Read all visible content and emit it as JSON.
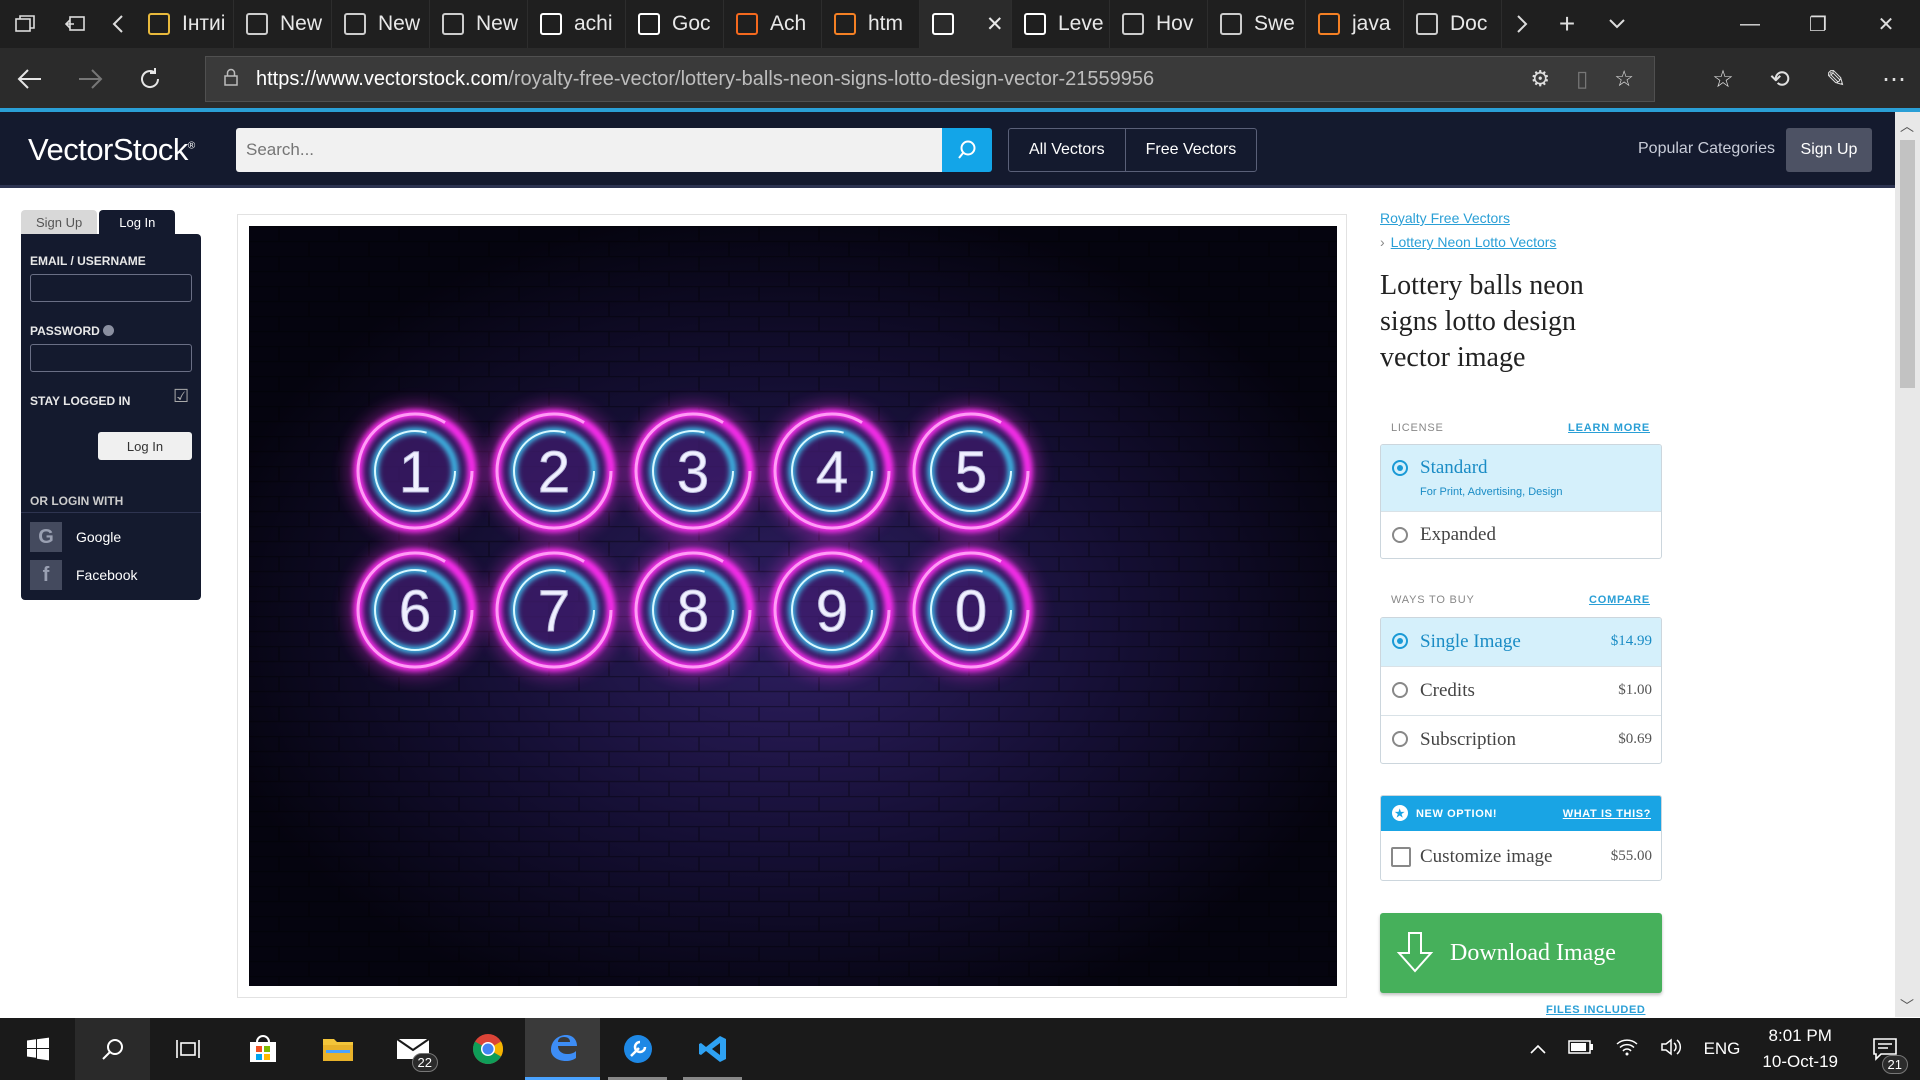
{
  "browser": {
    "tabs": [
      {
        "label": "Інтиі",
        "icon": "bookmark-icon",
        "color": "#e8b93c"
      },
      {
        "label": "New",
        "icon": "new-tab-icon",
        "color": "#cccccc"
      },
      {
        "label": "New",
        "icon": "new-tab-icon",
        "color": "#cccccc"
      },
      {
        "label": "New",
        "icon": "new-tab-icon",
        "color": "#cccccc"
      },
      {
        "label": "achi",
        "icon": "google-icon",
        "color": "#ffffff"
      },
      {
        "label": "Goc",
        "icon": "google-icon",
        "color": "#ffffff"
      },
      {
        "label": "Ach",
        "icon": "blogger-icon",
        "color": "#f4691e"
      },
      {
        "label": "htm",
        "icon": "stackoverflow-icon",
        "color": "#f48024"
      },
      {
        "label": "",
        "icon": "vectorstock-icon",
        "color": "#ffffff"
      },
      {
        "label": "Leve",
        "icon": "vectorstock-icon",
        "color": "#ffffff"
      },
      {
        "label": "Hov",
        "icon": "codepen-icon",
        "color": "#cccccc"
      },
      {
        "label": "Swe",
        "icon": "window-icon",
        "color": "#cccccc"
      },
      {
        "label": "java",
        "icon": "stackoverflow-icon",
        "color": "#f48024"
      },
      {
        "label": "Doc",
        "icon": "window-icon",
        "color": "#cccccc"
      }
    ],
    "url_domain": "https://www.vectorstock.com",
    "url_path": "/royalty-free-vector/lottery-balls-neon-signs-lotto-design-vector-21559956"
  },
  "header": {
    "logo": "VectorStock",
    "logo_mark": "®",
    "search_placeholder": "Search...",
    "all_vectors": "All Vectors",
    "free_vectors": "Free Vectors",
    "popular_categories": "Popular Categories",
    "sign_up": "Sign Up"
  },
  "login": {
    "tab_signup": "Sign Up",
    "tab_login": "Log In",
    "email_label": "EMAIL / USERNAME",
    "password_label": "PASSWORD",
    "stay_logged_in": "STAY LOGGED IN",
    "login_button": "Log In",
    "or_login_with": "OR LOGIN WITH",
    "google": "Google",
    "facebook": "Facebook"
  },
  "image": {
    "balls": [
      "1",
      "2",
      "3",
      "4",
      "5",
      "6",
      "7",
      "8",
      "9",
      "0"
    ],
    "ring_outer_color": "#ff2ff0",
    "ring_inner_color": "#3fd5ff"
  },
  "product": {
    "breadcrumb_1": "Royalty Free Vectors",
    "breadcrumb_2": "Lottery Neon Lotto Vectors",
    "title": "Lottery balls neon signs lotto design vector image",
    "license_label": "LICENSE",
    "learn_more": "LEARN MORE",
    "licenses": [
      {
        "name": "Standard",
        "sub": "For Print, Advertising, Design"
      },
      {
        "name": "Expanded",
        "sub": ""
      }
    ],
    "ways_label": "WAYS TO BUY",
    "compare": "COMPARE",
    "buy_options": [
      {
        "name": "Single Image",
        "price": "$14.99"
      },
      {
        "name": "Credits",
        "price": "$1.00"
      },
      {
        "name": "Subscription",
        "price": "$0.69"
      }
    ],
    "new_option": "NEW OPTION!",
    "what_is_this": "WHAT IS THIS?",
    "customize": "Customize image",
    "customize_price": "$55.00",
    "download": "Download Image",
    "files_included": "FILES INCLUDED"
  },
  "taskbar": {
    "mail_badge": "22",
    "lang": "ENG",
    "time": "8:01 PM",
    "date": "10-Oct-19",
    "notif_count": "21"
  },
  "colors": {
    "header_bg": "#141a2e",
    "accent_blue": "#13a5e8",
    "download_green": "#46b05b",
    "selected_bg": "#d5f0fb"
  }
}
